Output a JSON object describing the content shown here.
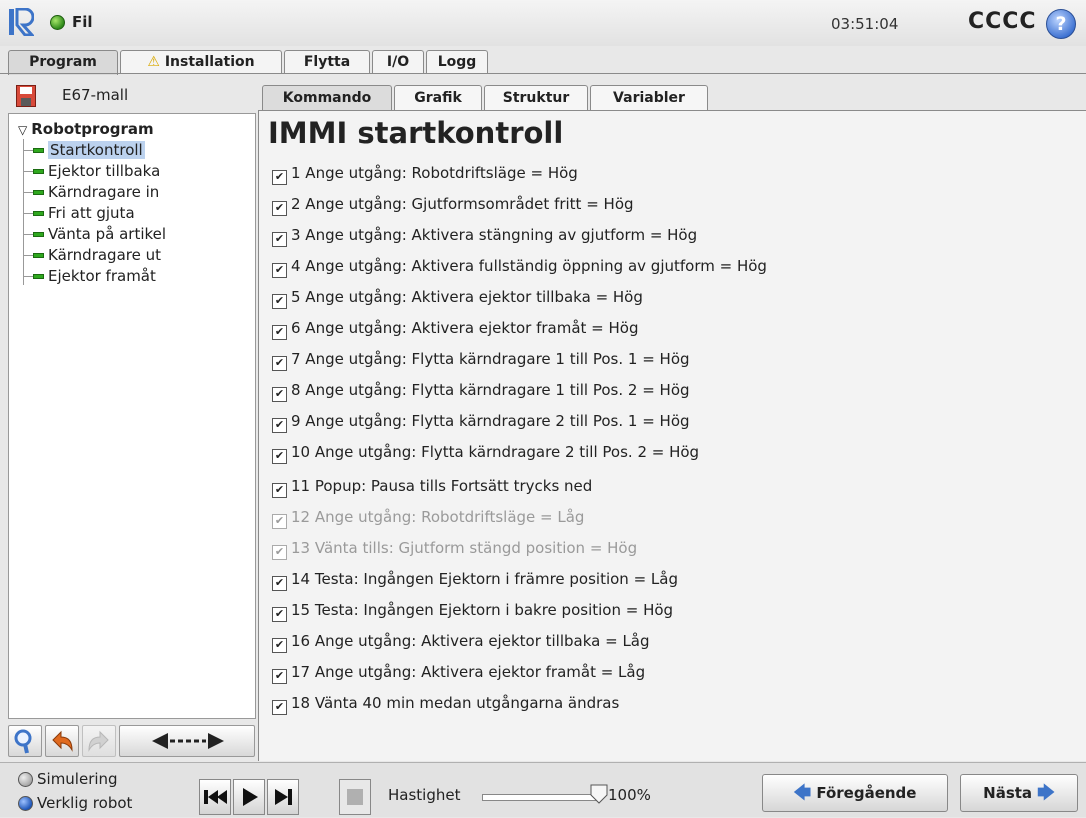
{
  "header": {
    "file_menu": "Fil",
    "clock": "03:51:04",
    "robot_name": "CCCC",
    "help_symbol": "?"
  },
  "main_tabs": [
    {
      "label": "Program",
      "active": true
    },
    {
      "label": "Installation",
      "icon": "warning-icon"
    },
    {
      "label": "Flytta"
    },
    {
      "label": "I/O"
    },
    {
      "label": "Logg"
    }
  ],
  "program": {
    "name": "E67-mall",
    "root": "Robotprogram",
    "items": [
      "Startkontroll",
      "Ejektor tillbaka",
      "Kärndragare in",
      "Fri att gjuta",
      "Vänta på artikel",
      "Kärndragare ut",
      "Ejektor framåt"
    ],
    "selected_index": 0
  },
  "content_tabs": [
    "Kommando",
    "Grafik",
    "Struktur",
    "Variabler"
  ],
  "active_content_tab": "Kommando",
  "page_title": "IMMI startkontroll",
  "commands": [
    {
      "text": "1 Ange utgång: Robotdriftsläge = Hög",
      "enabled": true
    },
    {
      "text": "2 Ange utgång: Gjutformsområdet fritt = Hög",
      "enabled": true
    },
    {
      "text": "3 Ange utgång: Aktivera stängning av gjutform = Hög",
      "enabled": true
    },
    {
      "text": "4 Ange utgång: Aktivera fullständig öppning av gjutform = Hög",
      "enabled": true
    },
    {
      "text": "5 Ange utgång: Aktivera ejektor tillbaka = Hög",
      "enabled": true
    },
    {
      "text": "6 Ange utgång: Aktivera ejektor framåt = Hög",
      "enabled": true
    },
    {
      "text": "7 Ange utgång: Flytta kärndragare 1 till Pos. 1 = Hög",
      "enabled": true
    },
    {
      "text": "8 Ange utgång: Flytta kärndragare 1 till Pos. 2 = Hög",
      "enabled": true
    },
    {
      "text": "9 Ange utgång: Flytta kärndragare 2 till Pos. 1 = Hög",
      "enabled": true
    },
    {
      "text": "10 Ange utgång: Flytta kärndragare 2 till Pos. 2 = Hög",
      "enabled": true
    },
    {
      "text": "11 Popup: Pausa tills Fortsätt trycks ned",
      "enabled": true
    },
    {
      "text": "12 Ange utgång: Robotdriftsläge = Låg",
      "enabled": false
    },
    {
      "text": "13 Vänta tills: Gjutform stängd position = Hög",
      "enabled": false
    },
    {
      "text": "14 Testa: Ingången Ejektorn i främre position = Låg",
      "enabled": true
    },
    {
      "text": "15 Testa: Ingången Ejektorn i bakre position = Hög",
      "enabled": true
    },
    {
      "text": "16 Ange utgång: Aktivera ejektor tillbaka = Låg",
      "enabled": true
    },
    {
      "text": "17 Ange utgång: Aktivera ejektor framåt = Låg",
      "enabled": true
    },
    {
      "text": "18 Vänta 40 min medan utgångarna ändras",
      "enabled": true
    }
  ],
  "footer": {
    "simulation_label": "Simulering",
    "real_robot_label": "Verklig robot",
    "mode_selected": "Verklig robot",
    "speed_label": "Hastighet",
    "speed_value": "100%",
    "speed_fraction": 1.0,
    "prev_label": "Föregående",
    "next_label": "Nästa"
  },
  "colors": {
    "accent_blue": "#3d74c8",
    "active_green": "#2fa81e",
    "selection": "#bcd2ee"
  }
}
